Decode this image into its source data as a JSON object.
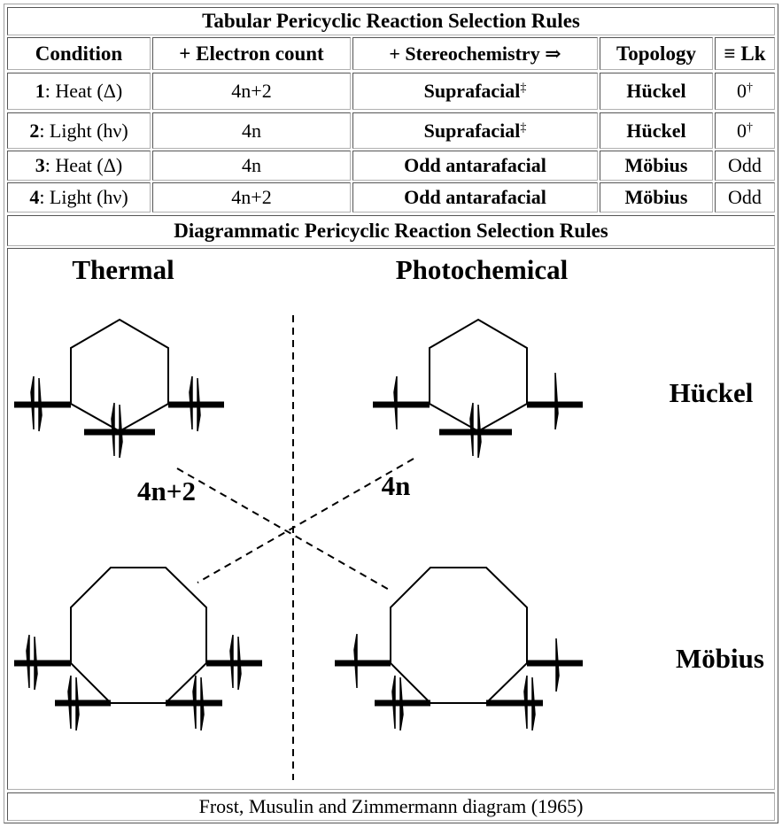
{
  "table": {
    "title": "Tabular Pericyclic Reaction Selection Rules",
    "headers": [
      "Condition",
      "+ Electron count",
      "+ Stereochemistry ⇒",
      "Topology",
      "≡ Lk"
    ],
    "rows": [
      {
        "num": "1",
        "condition": ": Heat (Δ)",
        "electrons": "4n+2",
        "stereo": "Suprafacial",
        "stereo_mark": "‡",
        "topology": "Hückel",
        "lk": "0",
        "lk_mark": "†"
      },
      {
        "num": "2",
        "condition": ": Light (hν)",
        "electrons": "4n",
        "stereo": "Suprafacial",
        "stereo_mark": "‡",
        "topology": "Hückel",
        "lk": "0",
        "lk_mark": "†"
      },
      {
        "num": "3",
        "condition": ": Heat (Δ)",
        "electrons": "4n",
        "stereo": "Odd antarafacial",
        "stereo_mark": "",
        "topology": "Möbius",
        "lk": "Odd",
        "lk_mark": ""
      },
      {
        "num": "4",
        "condition": ": Light (hν)",
        "electrons": "4n+2",
        "stereo": "Odd antarafacial",
        "stereo_mark": "",
        "topology": "Möbius",
        "lk": "Odd",
        "lk_mark": ""
      }
    ]
  },
  "diagram": {
    "title": "Diagrammatic Pericyclic Reaction Selection Rules",
    "col_thermal": "Thermal",
    "col_photochemical": "Photochemical",
    "row_huckel": "Hückel",
    "row_mobius": "Möbius",
    "label_4n2": "4n+2",
    "label_4n": "4n"
  },
  "caption": "Frost, Musulin and Zimmermann diagram (1965)"
}
